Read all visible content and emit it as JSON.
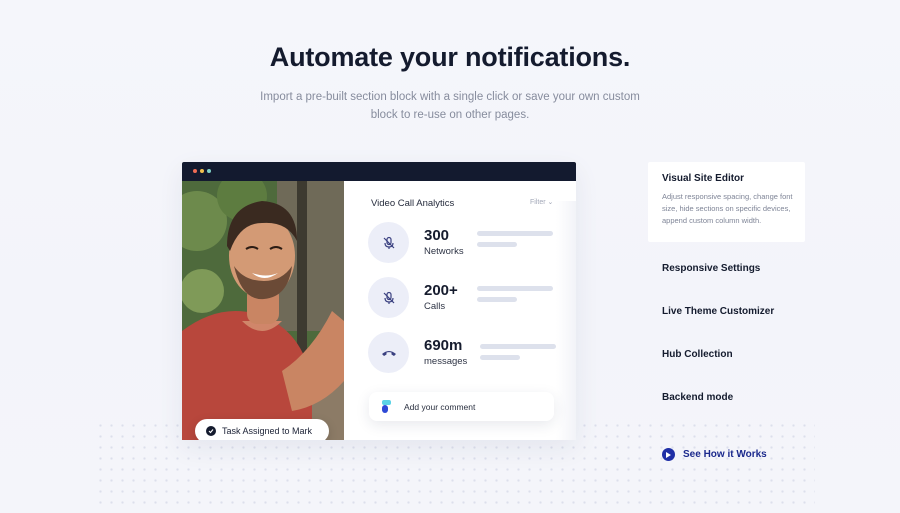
{
  "hero": {
    "title": "Automate your notifications.",
    "subtitle": "Import a pre-built section block with a single click or save your own custom block to re-use on other pages."
  },
  "mockup": {
    "task_chip": "Task Assigned to Mark",
    "panel": {
      "title": "Video Call Analytics",
      "filter_label": "Filter",
      "stats": [
        {
          "value": "300",
          "label": "Networks",
          "icon": "mic-off-icon"
        },
        {
          "value": "200+",
          "label": "Calls",
          "icon": "mic-off-icon"
        },
        {
          "value": "690m",
          "label": "messages",
          "icon": "phone-hangup-icon"
        }
      ],
      "comment_placeholder": "Add your comment"
    },
    "window_dots": [
      "#ef6b54",
      "#f2c14e",
      "#7fd0c6"
    ]
  },
  "features": {
    "active": {
      "title": "Visual Site Editor",
      "description": "Adjust responsive spacing, change font size, hide sections on specific devices, append custom column width."
    },
    "items": [
      "Responsive Settings",
      "Live Theme Customizer",
      "Hub Collection",
      "Backend mode"
    ],
    "cta": "See How it Works"
  },
  "colors": {
    "accent": "#1f2fa6",
    "dark": "#131a2f",
    "icon_bg": "#eceef8"
  }
}
